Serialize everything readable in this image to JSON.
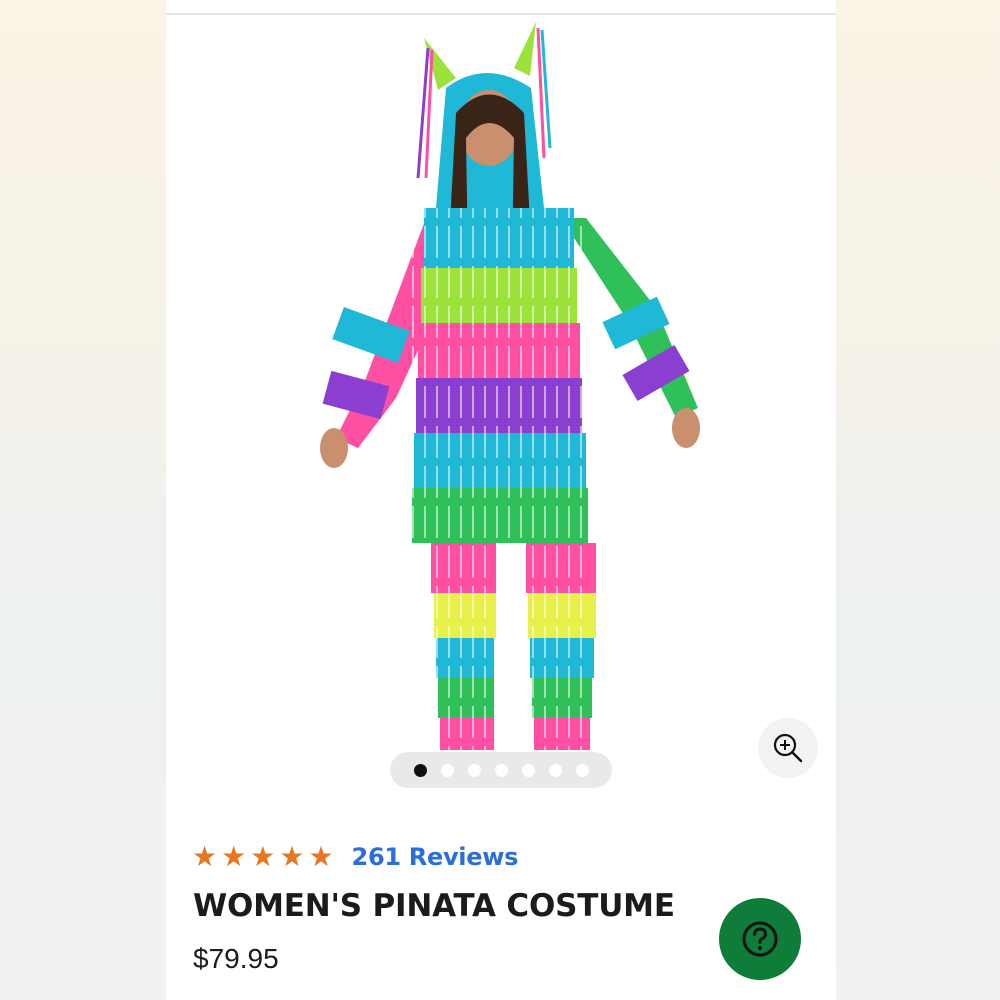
{
  "product": {
    "title": "WOMEN'S PINATA COSTUME",
    "price": "$79.95",
    "rating_stars": 5,
    "reviews_label": "261 Reviews"
  },
  "gallery": {
    "image_count": 7,
    "active_index": 0,
    "zoom_icon": "zoom-in-icon"
  },
  "help": {
    "icon": "question-circle-icon"
  },
  "colors": {
    "star": "#e87722",
    "reviews_link": "#2a6fd6",
    "help_button": "#0e7d3a",
    "costume": [
      "#ff4fa3",
      "#9be23a",
      "#1fb8d6",
      "#8a3fd1",
      "#2fc05a",
      "#e8f04a"
    ]
  }
}
